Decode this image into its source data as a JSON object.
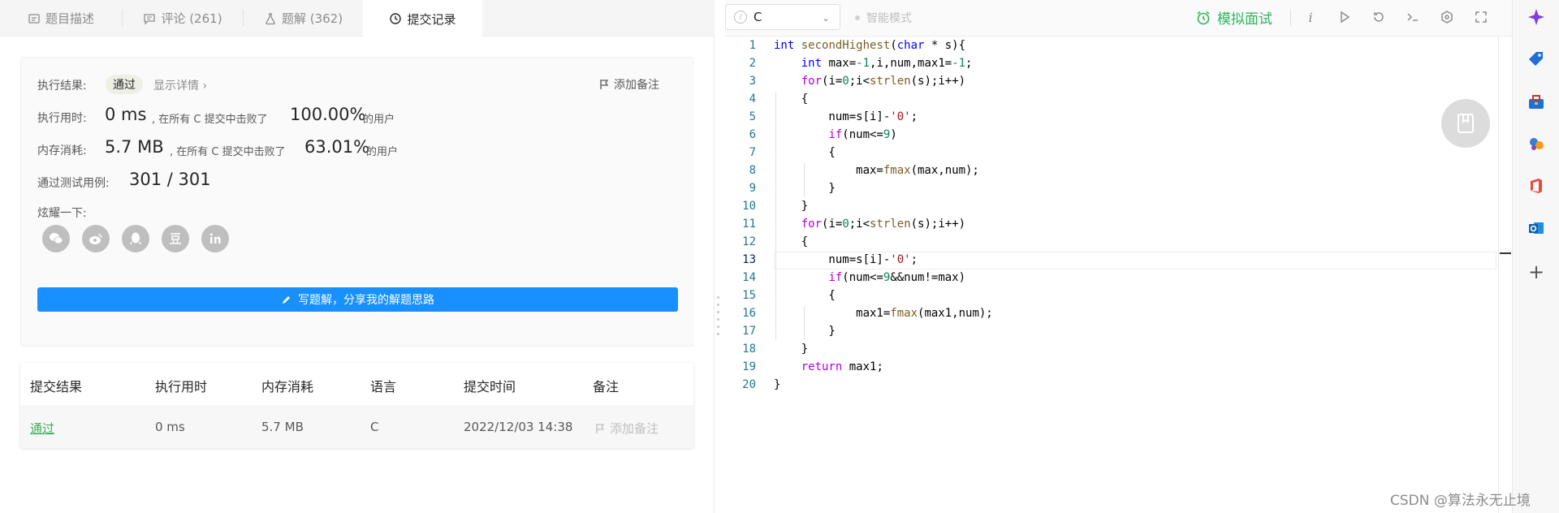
{
  "tabs": [
    {
      "label": "题目描述"
    },
    {
      "label": "评论 (261)"
    },
    {
      "label": "题解 (362)"
    },
    {
      "label": "提交记录"
    }
  ],
  "result": {
    "exec_result_label": "执行结果:",
    "status": "通过",
    "show_details": "显示详情 ›",
    "add_note": "添加备注",
    "time_label": "执行用时:",
    "time_value": "0 ms",
    "time_text": ", 在所有 C 提交中击败了",
    "time_percent": "100.00%",
    "users_text": "的用户",
    "mem_label": "内存消耗:",
    "mem_value": "5.7 MB",
    "mem_text": ", 在所有 C 提交中击败了",
    "mem_percent": "63.01%",
    "tests_label": "通过测试用例:",
    "tests_value": "301 / 301",
    "share_label": "炫耀一下:",
    "write_button": "写题解，分享我的解题思路"
  },
  "share_icons": [
    "wechat-icon",
    "weibo-icon",
    "qq-icon",
    "douban-icon",
    "linkedin-icon"
  ],
  "submissions": {
    "headers": [
      "提交结果",
      "执行用时",
      "内存消耗",
      "语言",
      "提交时间",
      "备注"
    ],
    "rows": [
      {
        "status": "通过",
        "time": "0 ms",
        "memory": "5.7 MB",
        "language": "C",
        "submitted": "2022/12/03 14:38",
        "note": "添加备注"
      }
    ]
  },
  "toolbar": {
    "language": "C",
    "smart_mode": "智能模式",
    "mock_interview": "模拟面试"
  },
  "editor": {
    "line_numbers": [
      "1",
      "2",
      "3",
      "4",
      "5",
      "6",
      "7",
      "8",
      "9",
      "10",
      "11",
      "12",
      "13",
      "14",
      "15",
      "16",
      "17",
      "18",
      "19",
      "20"
    ],
    "current_line": 13
  },
  "watermark": "CSDN @算法永无止境",
  "colors": {
    "accent": "#1890ff",
    "success": "#2db55d",
    "sidebar_star": "#7b3fe4"
  }
}
